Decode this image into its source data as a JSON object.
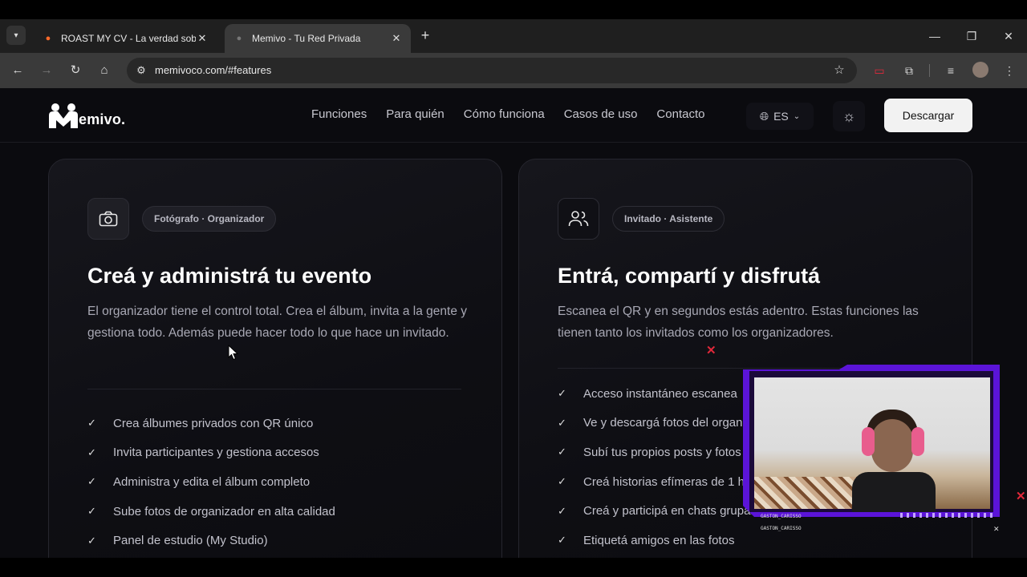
{
  "browser": {
    "tabs": [
      {
        "title": "ROAST MY CV - La verdad sobre",
        "active": false
      },
      {
        "title": "Memivo - Tu Red Privada",
        "active": true
      }
    ],
    "url": "memivoco.com/#features"
  },
  "site": {
    "logo_text": "emivo.",
    "nav": [
      "Funciones",
      "Para quién",
      "Cómo funciona",
      "Casos de uso",
      "Contacto"
    ],
    "lang": "ES",
    "download_label": "Descargar"
  },
  "cards": [
    {
      "icon": "camera-icon",
      "tag": "Fotógrafo · Organizador",
      "title": "Creá y administrá tu evento",
      "description": "El organizador tiene el control total. Crea el álbum, invita a la gente y gestiona todo. Además puede hacer todo lo que hace un invitado.",
      "features": [
        "Crea álbumes privados con QR único",
        "Invita participantes y gestiona accesos",
        "Administra y edita el álbum completo",
        "Sube fotos de organizador en alta calidad",
        "Panel de estudio (My Studio)"
      ]
    },
    {
      "icon": "users-icon",
      "tag": "Invitado · Asistente",
      "title": "Entrá, compartí y disfrutá",
      "description": "Escanea el QR y en segundos estás adentro. Estas funciones las tienen tanto los invitados como los organizadores.",
      "features": [
        "Acceso instantáneo escanea",
        "Ve y descargá fotos del organi",
        "Subí tus propios posts y fotos",
        "Creá historias efímeras de 1 h",
        "Creá y participá en chats grupales",
        "Etiquetá amigos en las fotos"
      ]
    }
  ],
  "stream_overlay": {
    "name_top": "GASTON_CARISSO",
    "name_bottom": "GASTON_CARISSO"
  },
  "colors": {
    "page_bg": "#0b0b0f",
    "overlay_frame": "#5b14d8",
    "close_marks": "#e0283a"
  }
}
